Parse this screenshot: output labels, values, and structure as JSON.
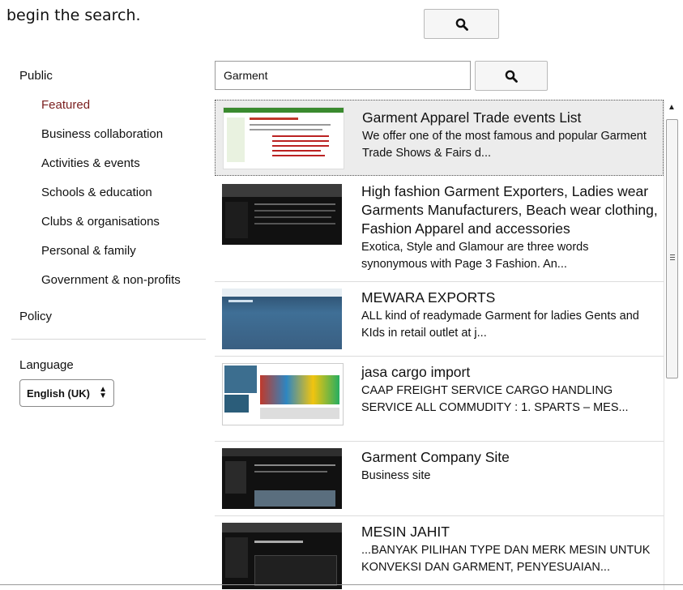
{
  "intro_text": "begin the search.",
  "sidebar": {
    "public_label": "Public",
    "items": [
      {
        "label": "Featured",
        "active": true
      },
      {
        "label": "Business collaboration"
      },
      {
        "label": "Activities & events"
      },
      {
        "label": "Schools & education"
      },
      {
        "label": "Clubs & organisations"
      },
      {
        "label": "Personal & family"
      },
      {
        "label": "Government & non-profits"
      }
    ],
    "policy_label": "Policy",
    "language_label": "Language",
    "language_value": "English (UK)"
  },
  "search": {
    "query": "Garment",
    "button_icon": "search-icon"
  },
  "results": [
    {
      "title": "Garment Apparel Trade events List",
      "desc": "We offer one of the most famous and popular Garment Trade Shows & Fairs d..."
    },
    {
      "title": "High fashion Garment Exporters, Ladies wear Garments Manufacturers, Beach wear clothing, Fashion Apparel and accessories",
      "desc": "Exotica, Style and Glamour are three words synonymous with Page 3 Fashion. An..."
    },
    {
      "title": "MEWARA EXPORTS",
      "desc": "ALL kind of readymade Garment for ladies Gents and KIds in retail outlet at j..."
    },
    {
      "title": "jasa cargo import",
      "desc": "CAAP FREIGHT SERVICE CARGO HANDLING SERVICE ALL COMMUDITY : 1. SPARTS – MES..."
    },
    {
      "title": "Garment Company Site",
      "desc": "Business site"
    },
    {
      "title": "MESIN JAHIT",
      "desc": "...BANYAK PILIHAN TYPE DAN MERK MESIN UNTUK KONVEKSI DAN GARMENT, PENYESUAIAN..."
    }
  ],
  "colors": {
    "accent_active": "#7a1f1f",
    "selected_bg": "#ececec"
  }
}
